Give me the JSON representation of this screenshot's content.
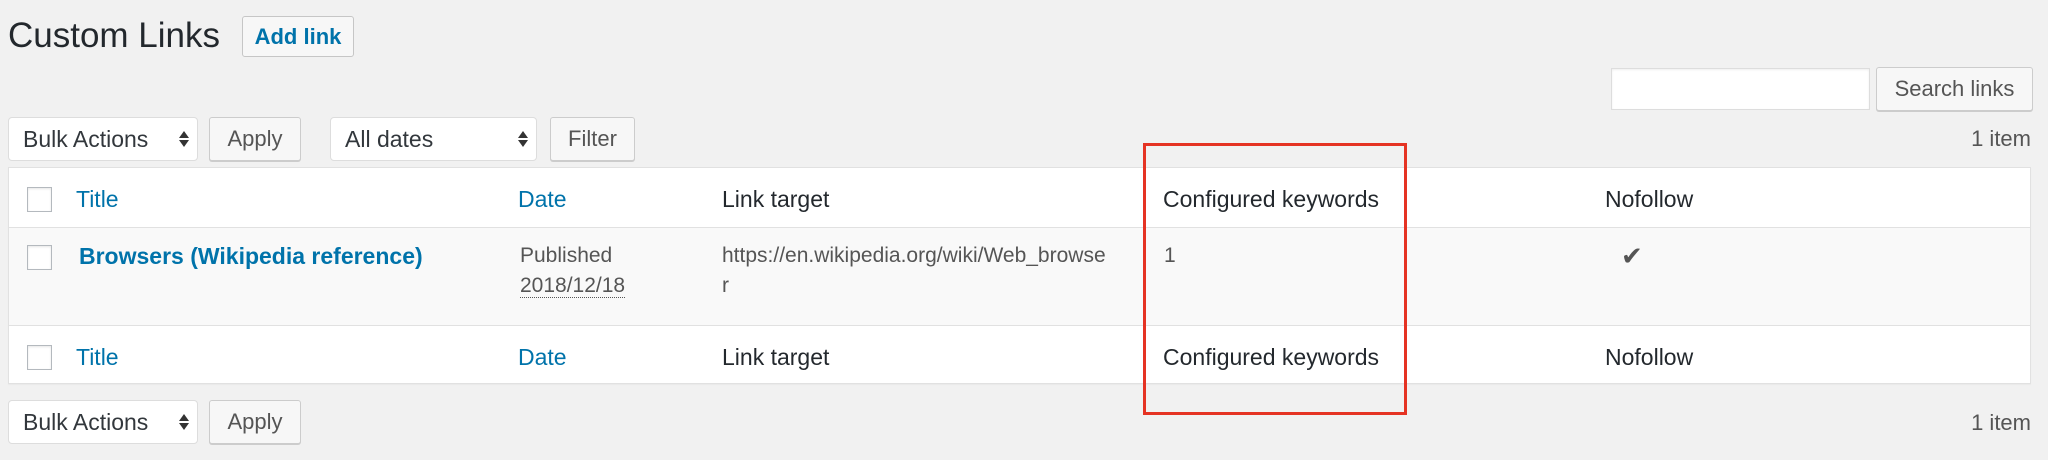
{
  "header": {
    "title": "Custom Links",
    "add_button": "Add link"
  },
  "search": {
    "value": "",
    "placeholder": "",
    "button_label": "Search links"
  },
  "top_nav": {
    "bulk_actions": "Bulk Actions",
    "apply": "Apply",
    "dates": "All dates",
    "filter": "Filter",
    "count": "1 item"
  },
  "table": {
    "columns": {
      "title": "Title",
      "date": "Date",
      "link_target": "Link target",
      "configured_keywords": "Configured keywords",
      "nofollow": "Nofollow"
    },
    "rows": [
      {
        "title": "Browsers (Wikipedia reference)",
        "status": "Published",
        "date": "2018/12/18",
        "link_target_line1": "https://en.wikipedia.org/wiki/Web_browse",
        "link_target_line2": "r",
        "configured_keywords": "1",
        "nofollow_icon": "checkmark-icon",
        "nofollow_glyph": "✔"
      }
    ]
  },
  "bottom_nav": {
    "bulk_actions": "Bulk Actions",
    "apply": "Apply",
    "count": "1 item"
  },
  "colors": {
    "link": "#0073aa",
    "highlight": "#e53323",
    "background": "#f1f1f1"
  }
}
